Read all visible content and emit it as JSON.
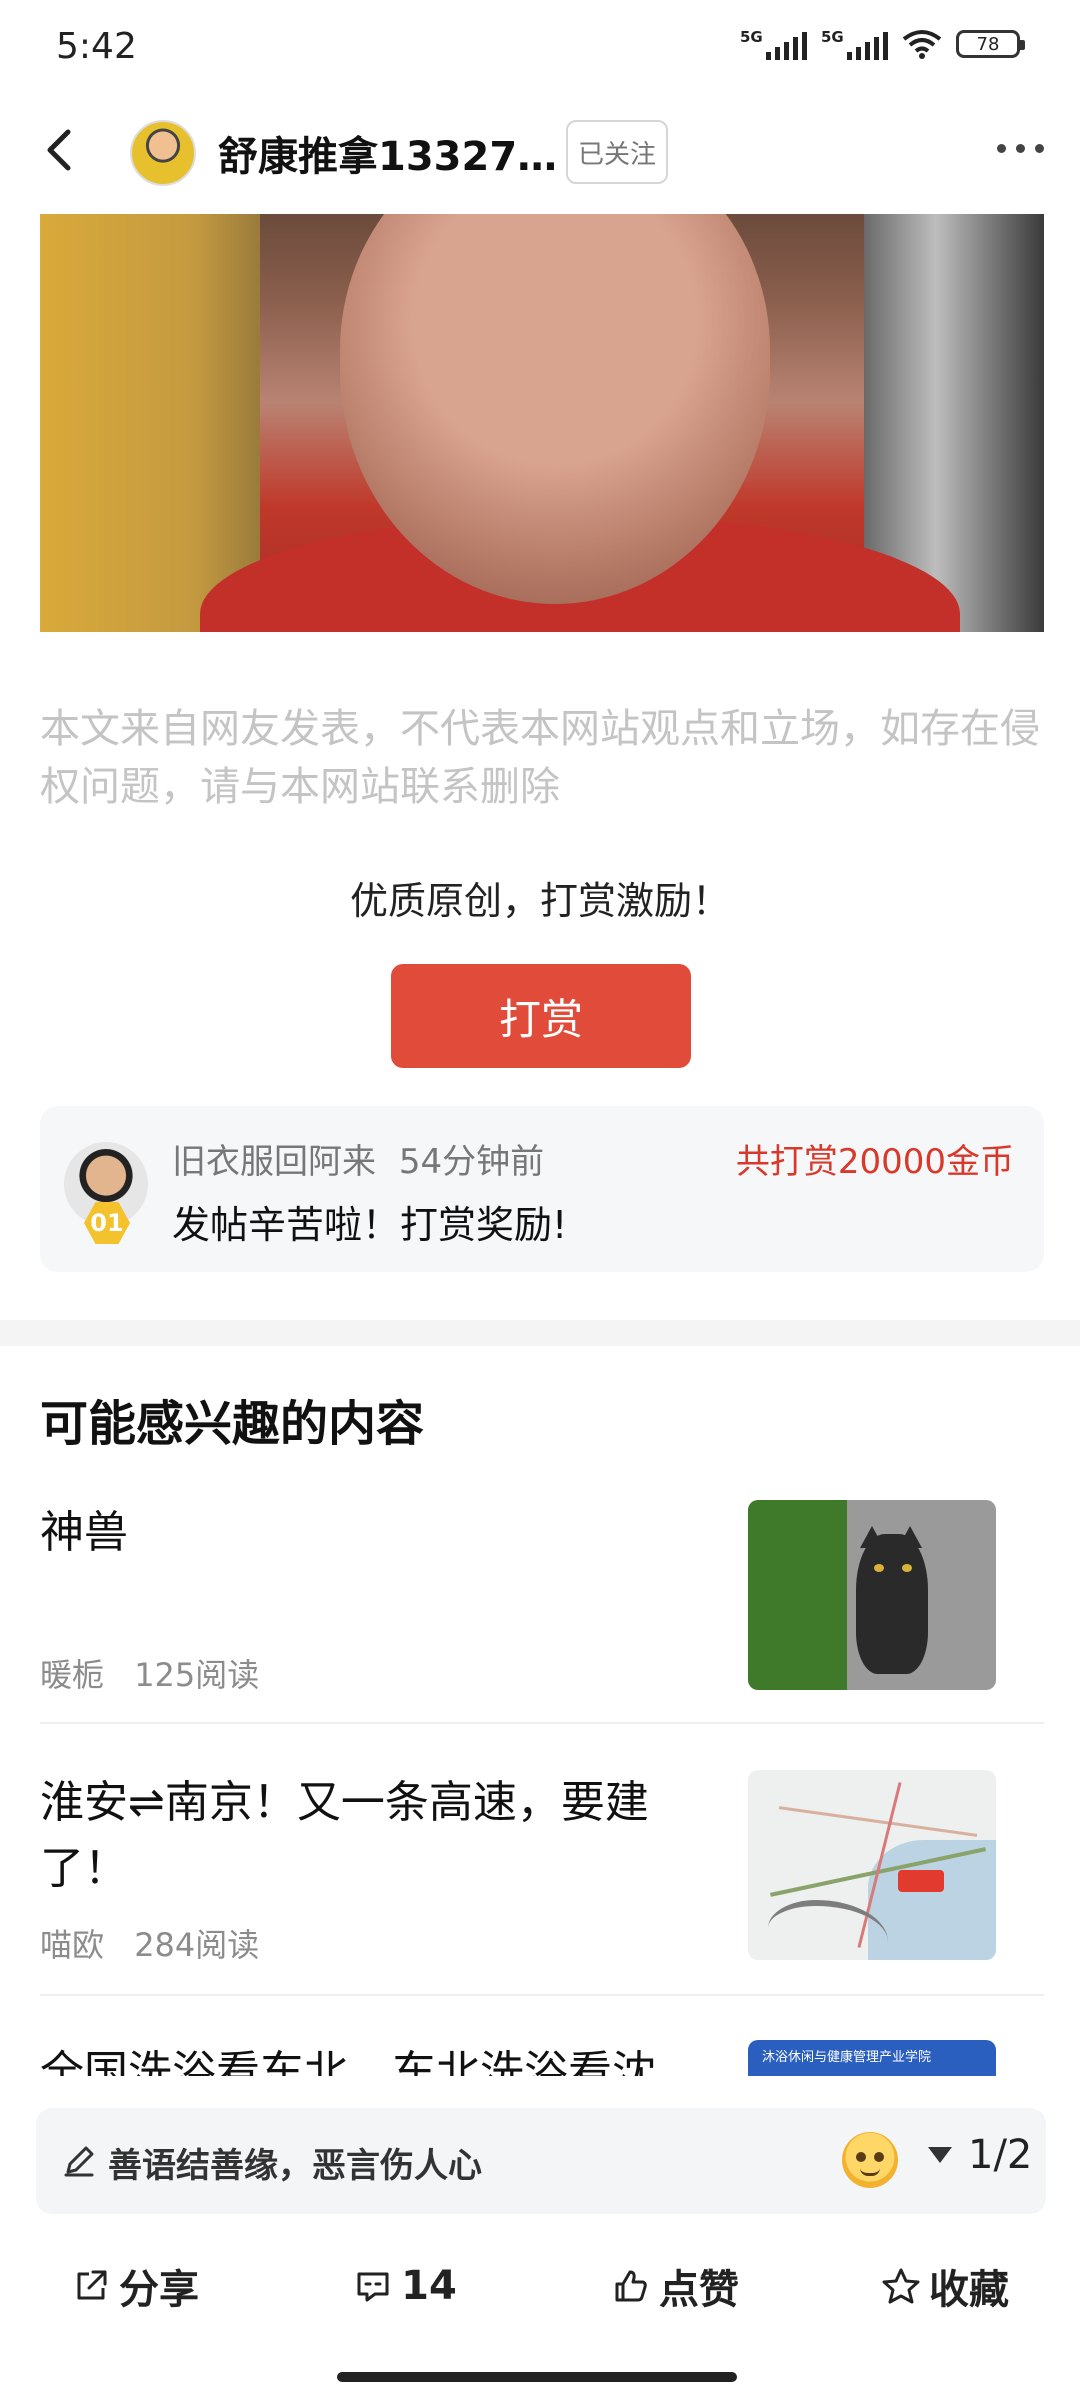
{
  "status_bar": {
    "time": "5:42",
    "network1": "5G",
    "network2": "5G",
    "battery": "78"
  },
  "header": {
    "author_name": "舒康推拿13327…",
    "follow_label": "已关注"
  },
  "article": {
    "disclaimer": "本文来自网友发表，不代表本网站观点和立场，如存在侵权问题，请与本网站联系删除"
  },
  "reward": {
    "prompt": "优质原创，打赏激励！",
    "button_label": "打赏"
  },
  "tip_record": {
    "tipper_name": "旧衣服回阿来",
    "time_ago": "54分钟前",
    "total": "共打赏20000金币",
    "message": "发帖辛苦啦！打赏奖励!",
    "rank": "01"
  },
  "recommend": {
    "section_title": "可能感兴趣的内容",
    "items": [
      {
        "title": "神兽",
        "author": "暖栀",
        "reads": "125阅读"
      },
      {
        "title": "淮安⇌南京！又一条高速，要建了！",
        "author": "喵欧",
        "reads": "284阅读"
      },
      {
        "title": "全国洗浴看东北，东北洗浴看沈",
        "thumb_caption": "沐浴休闲与健康管理产业学院"
      }
    ]
  },
  "bottom_bar": {
    "comment_placeholder": "善语结善缘，恶言伤人心",
    "page_indicator": "1/2",
    "share_label": "分享",
    "comment_count": "14",
    "like_label": "点赞",
    "favorite_label": "收藏"
  },
  "colors": {
    "accent": "#e04b3a",
    "tip_total": "#d8392b"
  },
  "icons": [
    "back-icon",
    "more-icon",
    "pencil-icon",
    "emoji-icon",
    "share-icon",
    "comment-icon",
    "like-icon",
    "star-icon"
  ]
}
